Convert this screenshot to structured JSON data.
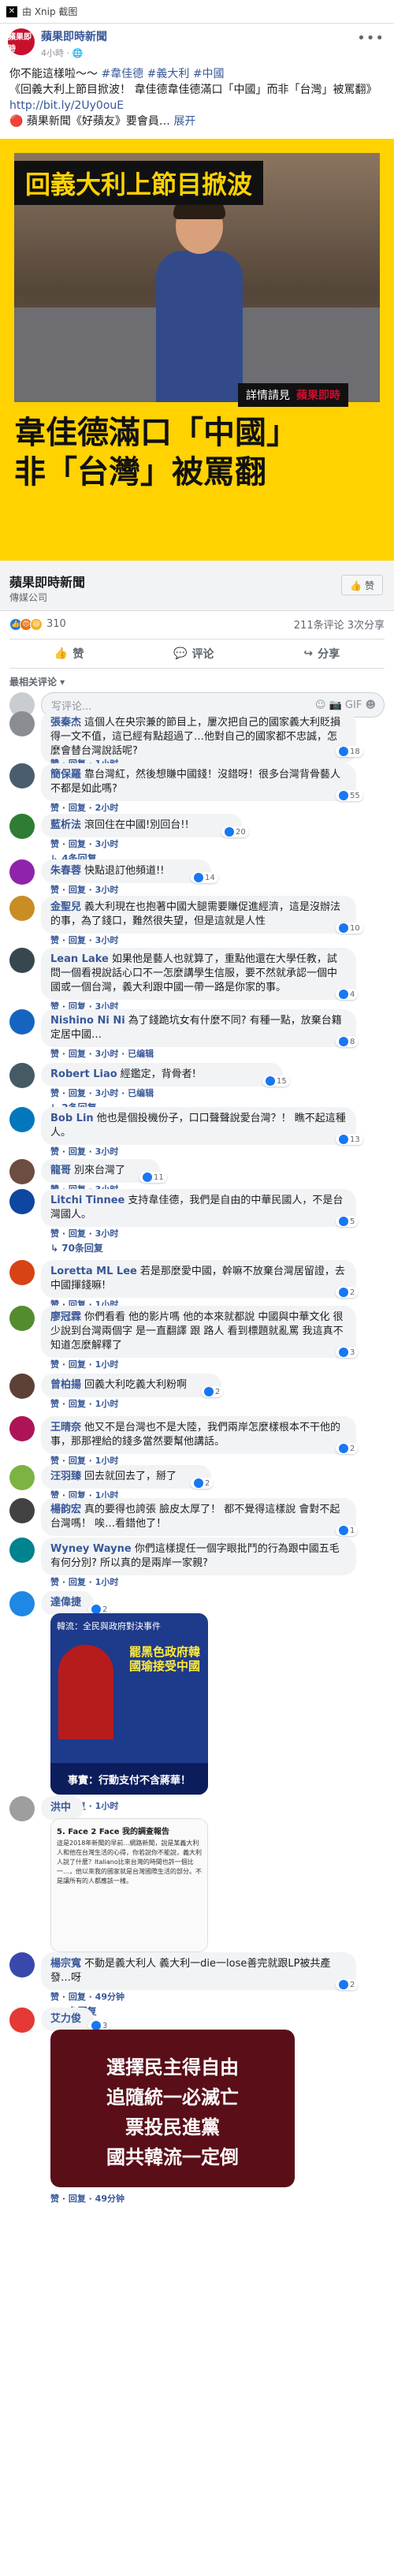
{
  "window": {
    "title": "由 Xnip 截图"
  },
  "post": {
    "page_name": "蘋果即時新聞",
    "avatar_text": "蘋果即時",
    "time": "4小時 ·",
    "line1": "你不能這樣啦～～",
    "hashtags": [
      "#韋佳德",
      "#義大利",
      "#中國"
    ],
    "line2": "《回義大利上節目掀波！ 韋佳德韋佳德滿口「中國」而非「台灣」被罵翻》",
    "link": "http://bit.ly/2Uy0ouE",
    "line3": "🔴 蘋果新聞《好蘋友》要會員…",
    "expand": "展开",
    "image": {
      "banner": "回義大利上節目掀波",
      "more": "詳情請見",
      "brand": "蘋果即時",
      "caption1": "韋佳德滿口「中國」",
      "caption2": "非「台灣」被罵翻"
    },
    "source_title": "蘋果即時新聞",
    "source_sub": "傳媒公司",
    "source_like": "👍 赞",
    "reactions_count": "310",
    "stats_right": "211条评论 3次分享",
    "actions": {
      "like": "赞",
      "comment": "评论",
      "share": "分享"
    },
    "sort": "最相关评论 ▾",
    "write_placeholder": "写评论...",
    "write_icons": "☺ 📷 GIF ☻"
  },
  "comments": [
    {
      "name": "張秦杰",
      "text": "這個人在央宗兼的節目上，屢次把自己的國家義大利貶損得一文不值，這已經有點超過了…他對自己的國家都不忠誠，怎麼會替台灣說話呢?",
      "meta": "赞 · 回复 · 1小时",
      "count": "18",
      "color": "#8a8d91"
    },
    {
      "name": "簡保羅",
      "text": "靠台灣紅，然後想賺中國錢！沒錯呀！很多台灣背骨藝人不都是如此嗎?",
      "meta": "赞 · 回复 · 2小时",
      "count": "55",
      "color": "#4a5d6e",
      "reply": "↳ 6条回复"
    },
    {
      "name": "藍析法",
      "text": "滾回住在中國!別回台!!",
      "meta": "赞 · 回复 · 3小时",
      "count": "20",
      "color": "#2e7d32",
      "reply": "↳ 4条回复"
    },
    {
      "name": "朱春蓉",
      "text": "快點退訂他頻道!!",
      "meta": "赞 · 回复 · 3小时",
      "count": "14",
      "color": "#8e24aa",
      "reply": "↳ 4条回复"
    },
    {
      "name": "金聖兒",
      "text": "義大利現在也抱著中國大腿需要賺促進經濟，這是沒辦法的事，為了錢口，難然很失望，但是這就是人性",
      "meta": "赞 · 回复 · 3小时",
      "count": "10",
      "color": "#c98d26",
      "reply": "↳ 2条回复"
    },
    {
      "name": "Lean Lake",
      "text": "如果他是藝人也就算了，重點他還在大學任教，試問一個看視說話心口不一怎麼講學生信服，要不然就承認一個中國或一個台灣，義大利跟中國一帶一路是你家的事。",
      "meta": "赞 · 回复 · 3小时",
      "count": "4",
      "color": "#37474f"
    },
    {
      "name": "Nishino Ni Ni",
      "text": "為了錢跪坑女有什麼不同? 有種一點，放棄台籍定居中國…",
      "meta": "赞 · 回复 · 3小时 · 已编辑",
      "count": "8",
      "color": "#1565c0"
    },
    {
      "name": "Robert Liao",
      "text": "經鑑定，背骨者!",
      "meta": "赞 · 回复 · 3小时 · 已编辑",
      "count": "15",
      "color": "#455a64",
      "reply": "↳ 2条回复"
    },
    {
      "name": "Bob Lin",
      "text": "他也是個投機份子，口口聲聲說愛台灣？！ 瞧不起這種人。",
      "meta": "赞 · 回复 · 3小时",
      "count": "13",
      "color": "#0277bd"
    },
    {
      "name": "龍哥",
      "text": "別來台灣了",
      "meta": "赞 · 回复 · 3小时",
      "count": "11",
      "color": "#6d4c41"
    },
    {
      "name": "Litchi Tinnee",
      "text": "支持韋佳德，我們是自由的中華民國人，不是台灣國人。",
      "meta": "赞 · 回复 · 3小时",
      "count": "5",
      "color": "#0d47a1",
      "reply": "↳ 70条回复"
    },
    {
      "name": "Loretta ML Lee",
      "text": "若是那麼愛中國，幹嘛不放棄台灣居留證，去中國揮錢嘛!",
      "meta": "赞 · 回复 · 1小时",
      "count": "2",
      "color": "#d84315"
    },
    {
      "name": "廖冠霖",
      "text": "你們看看 他的影片嗎 他的本來就都說 中國與中華文化 很少說到台灣兩個字 是一直翻譯 跟 路人 看到標題就亂罵 我這真不知道怎麼解釋了",
      "meta": "赞 · 回复 · 1小时",
      "count": "3",
      "color": "#558b2f",
      "reply": "↳ 50条回复 · 1小时"
    },
    {
      "name": "曾柏揚",
      "text": "回義大利吃義大利粉啊",
      "meta": "赞 · 回复 · 1小时",
      "count": "2",
      "color": "#5d4037"
    },
    {
      "name": "王晴奈",
      "text": "他又不是台灣也不是大陸，我們兩岸怎麼樣根本不干他的事，那那裡給的錢多當然要幫他講話。",
      "meta": "赞 · 回复 · 1小时",
      "count": "2",
      "color": "#ad1457"
    },
    {
      "name": "汪羽臻",
      "text": "回去就回去了，掰了",
      "meta": "赞 · 回复 · 1小时",
      "count": "2",
      "color": "#7cb342"
    },
    {
      "name": "楊韵宏",
      "text": "真的要得也誇張 臉皮太厚了！ 都不覺得這樣說 會對不起台灣嗎！ 唉…看錯他了！",
      "meta": "赞 · 回复 · 1小时",
      "count": "1",
      "color": "#424242"
    },
    {
      "name": "Wyney Wayne",
      "text": "你們這樣提任一個字眼批鬥的行為跟中國五毛有何分別? 所以真的是兩岸一家親?",
      "meta": "赞 · 回复 · 1小时",
      "count": "",
      "color": "#00838f"
    },
    {
      "name": "達偉捷",
      "text": "",
      "meta": "赞 · 回复 · 1小时",
      "count": "2",
      "color": "#1e88e5",
      "image": "poster1"
    },
    {
      "name": "洪中",
      "text": "",
      "meta": "赞 · 回复 · 49分钟",
      "count": "",
      "color": "#9e9e9e",
      "image": "screenshot"
    },
    {
      "name": "楊宗寬",
      "text": "不動是義大利人 義大利一die一lose善完就跟LP被共產發…呀",
      "meta": "赞 · 回复 · 49分钟",
      "count": "2",
      "color": "#3949ab",
      "reply": "↳ 2条回复"
    },
    {
      "name": "艾力俊",
      "text": "",
      "meta": "赞 · 回复 · 49分钟",
      "count": "3",
      "color": "#e53935",
      "image": "slogan"
    }
  ],
  "images": {
    "poster1": {
      "title": "韓流：全民與政府對決事件",
      "big": "罷黑色政府韓國瑜接受中國",
      "foot": "事實：行動支付不含蔣華！"
    },
    "screenshot": {
      "title": "5. Face 2 Face 我的調查報告",
      "body": "這是2018年新聞的早前…網路新聞，說是某義大利人和他在台灣生活的心得，你若說你不能說，義大利人說了什麼？Italiano比來台灣的時間也許一個比一…，他以來我的國家就是台灣國際生活的部分。不是讓所有的人都應該一樣。"
    },
    "slogan": {
      "lines": [
        "選擇民主得自由",
        "追隨統一必滅亡",
        "票投民進黨",
        "國共韓流一定倒"
      ]
    }
  }
}
